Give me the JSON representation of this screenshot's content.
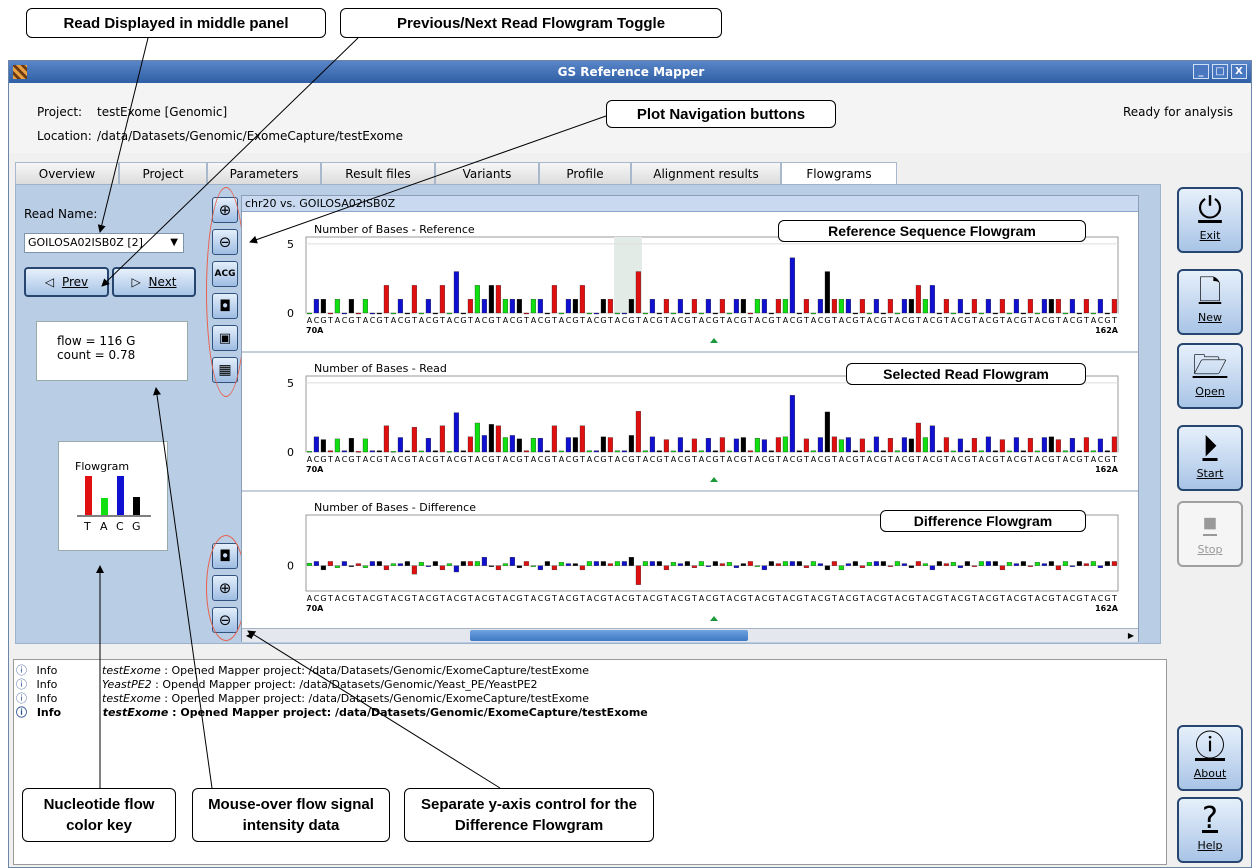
{
  "callouts": {
    "read_displayed": "Read Displayed in middle panel",
    "prev_next_toggle": "Previous/Next Read Flowgram Toggle",
    "plot_nav": "Plot Navigation buttons",
    "ref_flowgram": "Reference Sequence Flowgram",
    "selected_read_flowgram": "Selected Read Flowgram",
    "difference_flowgram": "Difference Flowgram",
    "nucleotide_key": "Nucleotide flow color key",
    "mouseover": "Mouse-over flow signal intensity data",
    "separate_yaxis": "Separate y-axis control for the Difference Flowgram"
  },
  "window": {
    "title": "GS Reference Mapper",
    "controls": [
      "_",
      "□",
      "X"
    ]
  },
  "header": {
    "project_label": "Project:",
    "project_value": "testExome  [Genomic]",
    "location_label": "Location:",
    "location_value": "/data/Datasets/Genomic/ExomeCapture/testExome",
    "status": "Ready for analysis"
  },
  "tabs": [
    {
      "label": "Overview"
    },
    {
      "label": "Project"
    },
    {
      "label": "Parameters"
    },
    {
      "label": "Result files"
    },
    {
      "label": "Variants"
    },
    {
      "label": "Profile"
    },
    {
      "label": "Alignment results"
    },
    {
      "label": "Flowgrams"
    }
  ],
  "active_tab": "Flowgrams",
  "left": {
    "read_name_label": "Read Name:",
    "read_name_value": "GOILOSA02ISB0Z [2]",
    "prev_label": "Prev",
    "next_label": "Next",
    "flow_text": "flow = 116 G",
    "count_text": "count = 0.78",
    "key_title": "Flowgram",
    "key_letters": [
      "T",
      "A",
      "C",
      "G"
    ]
  },
  "plot_header": "chr20 vs. GOILOSA02ISB0Z",
  "side_buttons": [
    {
      "label": "Exit",
      "icon": "power-icon"
    },
    {
      "label": "New",
      "icon": "new-document-icon"
    },
    {
      "label": "Open",
      "icon": "folder-open-icon"
    },
    {
      "label": "Start",
      "icon": "play-icon"
    },
    {
      "label": "Stop",
      "icon": "stop-icon"
    },
    {
      "label": "About",
      "icon": "info-icon"
    },
    {
      "label": "Help",
      "icon": "help-icon"
    }
  ],
  "colors": {
    "T": "#e01010",
    "A": "#10e010",
    "C": "#1010d0",
    "G": "#000000"
  },
  "log": [
    {
      "level": "Info",
      "project": "testExome",
      "message": " : Opened Mapper project: /data/Datasets/Genomic/ExomeCapture/testExome",
      "bold": false
    },
    {
      "level": "Info",
      "project": "YeastPE2",
      "message": " : Opened Mapper project: /data/Datasets/Genomic/Yeast_PE/YeastPE2",
      "bold": false
    },
    {
      "level": "Info",
      "project": "testExome",
      "message": " : Opened Mapper project: /data/Datasets/Genomic/ExomeCapture/testExome",
      "bold": false
    },
    {
      "level": "Info",
      "project": "testExome",
      "message": " : Opened Mapper project: /data/Datasets/Genomic/ExomeCapture/testExome",
      "bold": true
    }
  ],
  "chart_data": [
    {
      "type": "bar",
      "title": "Number of Bases - Reference",
      "yticks": [
        0,
        5
      ],
      "ylim": [
        0,
        5.5
      ],
      "flow_order": "ACGT",
      "x_start_label": "70A",
      "x_end_label": "162A",
      "highlight_flows": [
        44,
        45,
        46,
        47
      ],
      "values": [
        0,
        1,
        1,
        0,
        1,
        0,
        1,
        0,
        1,
        0,
        0,
        2,
        0,
        1,
        0,
        2,
        0,
        1,
        0,
        2,
        0,
        3,
        0,
        1,
        2,
        1,
        2,
        2,
        1,
        1,
        1,
        0,
        1,
        1,
        0,
        2,
        0,
        1,
        1,
        2,
        0,
        0,
        1,
        1,
        0,
        0,
        1,
        3,
        0,
        1,
        0,
        1,
        0,
        1,
        0,
        1,
        0,
        1,
        0,
        1,
        0,
        1,
        1,
        0,
        1,
        1,
        0,
        1,
        1,
        4,
        0,
        1,
        0,
        1,
        3,
        1,
        1,
        1,
        0,
        1,
        0,
        1,
        0,
        1,
        0,
        1,
        1,
        2,
        1,
        2,
        0,
        1,
        0,
        1,
        0,
        1,
        0,
        1,
        0,
        1,
        0,
        1,
        0,
        1,
        0,
        1,
        1,
        1,
        0,
        1,
        0,
        1,
        0,
        1,
        0,
        1
      ]
    },
    {
      "type": "bar",
      "title": "Number of Bases - Read",
      "yticks": [
        0,
        5
      ],
      "ylim": [
        0,
        5.5
      ],
      "flow_order": "ACGT",
      "x_start_label": "70A",
      "x_end_label": "162A",
      "values": [
        0.06,
        1.1,
        0.9,
        0.1,
        0.95,
        0.1,
        1,
        0.05,
        0.95,
        0.1,
        0.1,
        1.9,
        0.05,
        1.05,
        0.1,
        1.8,
        0.08,
        1,
        0.1,
        1.9,
        0.05,
        2.85,
        0.1,
        1.1,
        2.1,
        1.2,
        2,
        1.9,
        1.05,
        1.2,
        0.95,
        0.1,
        1,
        1,
        0.1,
        1.9,
        0.08,
        1.05,
        1.05,
        1.9,
        0.1,
        0.1,
        1.1,
        1.05,
        0.1,
        0.1,
        1.2,
        2.95,
        0.1,
        1.1,
        0.1,
        0.9,
        0.08,
        1.05,
        0.1,
        0.95,
        0.1,
        1,
        0.1,
        1.05,
        0.08,
        0.95,
        1.05,
        0.1,
        1,
        0.9,
        0.1,
        1.05,
        1.1,
        4.1,
        0.1,
        0.95,
        0.1,
        1.05,
        2.9,
        1.1,
        0.9,
        1.05,
        0.1,
        0.95,
        0.08,
        1.1,
        0.1,
        1,
        0.1,
        1.05,
        0.95,
        2.1,
        1.05,
        1.9,
        0.1,
        1.05,
        0.08,
        0.95,
        0.1,
        1,
        0.1,
        1.1,
        0.1,
        0.9,
        0.08,
        1.05,
        0.1,
        1,
        0.08,
        1.05,
        1.1,
        0.9,
        0.1,
        1,
        0.1,
        1.05,
        0.1,
        0.95,
        0.1,
        1.1
      ]
    },
    {
      "type": "bar",
      "title": "Number of Bases - Difference",
      "yticks": [
        0
      ],
      "ylim": [
        -0.6,
        1.2
      ],
      "flow_order": "ACGT",
      "x_start_label": "70A",
      "x_end_label": "162A",
      "values": [
        0.06,
        0.1,
        -0.1,
        0.1,
        -0.05,
        0.1,
        0,
        0.05,
        -0.05,
        0.1,
        0.1,
        -0.1,
        0.05,
        0.05,
        0.1,
        -0.2,
        0.08,
        0,
        0.1,
        -0.1,
        0.05,
        -0.15,
        0.1,
        0.1,
        0.1,
        0.2,
        0,
        -0.1,
        0.05,
        0.2,
        -0.05,
        0.1,
        0,
        -0.1,
        0.1,
        -0.1,
        0.08,
        0.05,
        0.05,
        -0.1,
        0.1,
        0.1,
        0.1,
        0.05,
        0.1,
        0.1,
        0.2,
        -0.45,
        0.1,
        0.1,
        0.1,
        -0.1,
        0.08,
        0.05,
        0.1,
        -0.05,
        0.1,
        0,
        0.1,
        0.05,
        0.08,
        -0.05,
        0.05,
        0.1,
        0,
        -0.1,
        0.1,
        0.05,
        0.1,
        0.1,
        0.1,
        -0.05,
        0.1,
        0.05,
        -0.1,
        0.1,
        -0.1,
        0.05,
        0.1,
        -0.05,
        0.08,
        0.1,
        0.1,
        0,
        0.1,
        0.05,
        -0.05,
        0.1,
        0.05,
        -0.1,
        0.1,
        0.05,
        0.08,
        -0.05,
        0.1,
        0,
        0.1,
        0.1,
        0.1,
        -0.1,
        0.08,
        0.05,
        0.1,
        0,
        0.08,
        0.05,
        0.1,
        -0.1,
        0.1,
        0,
        0.1,
        0.05,
        0.1,
        -0.05,
        0.1,
        0.1
      ]
    }
  ]
}
